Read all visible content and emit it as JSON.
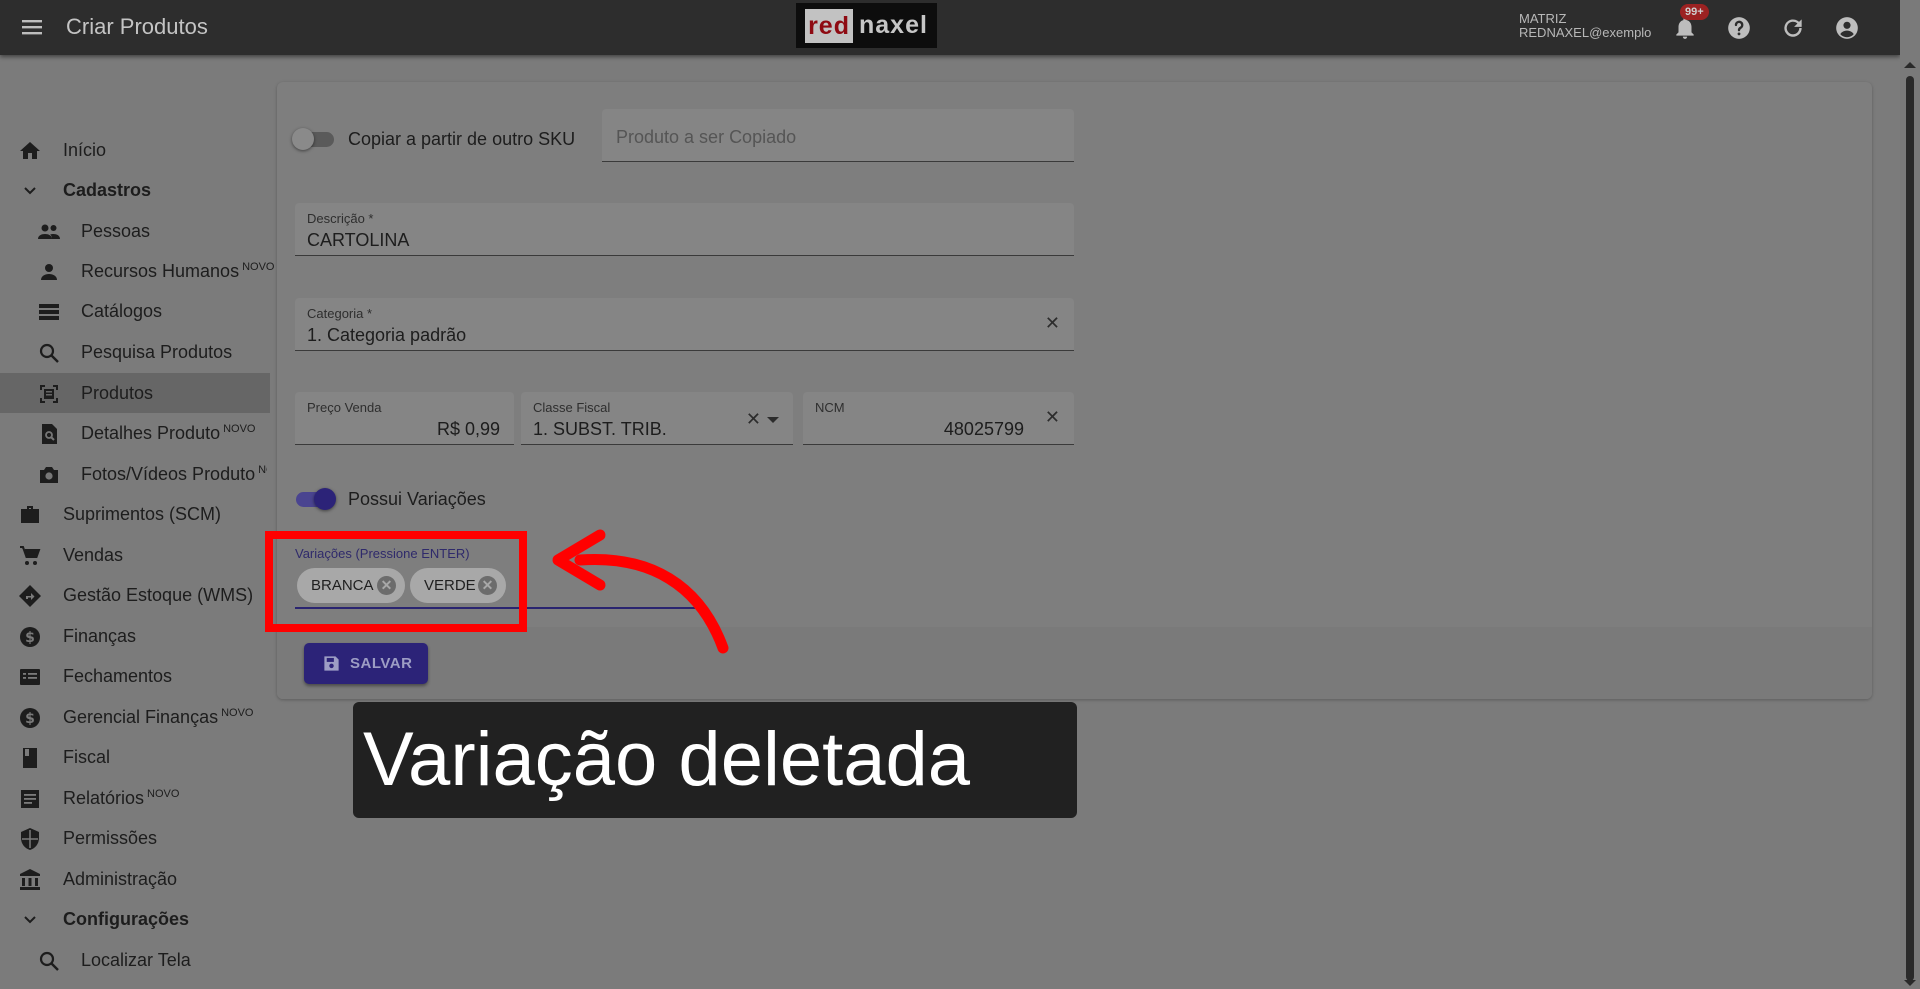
{
  "header": {
    "title": "Criar Produtos",
    "logo_red": "red",
    "logo_white": "naxel",
    "user_line1": "MATRIZ",
    "user_line2": "REDNAXEL@exemplo",
    "notification_count": "99+"
  },
  "sidebar": {
    "items": [
      {
        "label": "Início",
        "icon": "home-icon"
      },
      {
        "label": "Cadastros",
        "icon": "chevron-down-icon"
      },
      {
        "label": "Pessoas",
        "icon": "people-icon"
      },
      {
        "label": "Recursos Humanos",
        "badge": "NOVO",
        "icon": "person-icon"
      },
      {
        "label": "Catálogos",
        "icon": "list-icon"
      },
      {
        "label": "Pesquisa Produtos",
        "icon": "search-icon"
      },
      {
        "label": "Produtos",
        "icon": "product-icon"
      },
      {
        "label": "Detalhes Produto",
        "badge": "NOVO",
        "icon": "detail-search-icon"
      },
      {
        "label": "Fotos/Vídeos Produto",
        "badge": "NOVO",
        "icon": "camera-icon"
      },
      {
        "label": "Suprimentos (SCM)",
        "icon": "briefcase-icon"
      },
      {
        "label": "Vendas",
        "icon": "cart-icon"
      },
      {
        "label": "Gestão Estoque (WMS)",
        "icon": "directions-icon"
      },
      {
        "label": "Finanças",
        "icon": "dollar-icon"
      },
      {
        "label": "Fechamentos",
        "icon": "receipt-icon"
      },
      {
        "label": "Gerencial Finanças",
        "badge": "NOVO",
        "icon": "dollar-icon"
      },
      {
        "label": "Fiscal",
        "icon": "book-icon"
      },
      {
        "label": "Relatórios",
        "badge": "NOVO",
        "icon": "report-icon"
      },
      {
        "label": "Permissões",
        "icon": "shield-icon"
      },
      {
        "label": "Administração",
        "icon": "bank-icon"
      },
      {
        "label": "Configurações",
        "icon": "chevron-down-icon"
      },
      {
        "label": "Localizar Tela",
        "icon": "search-icon"
      }
    ]
  },
  "form": {
    "copy_label": "Copiar a partir de outro SKU",
    "copy_placeholder": "Produto a ser Copiado",
    "descricao_label": "Descrição *",
    "descricao_value": "CARTOLINA",
    "categoria_label": "Categoria *",
    "categoria_value": "1. Categoria padrão",
    "preco_label": "Preço Venda",
    "preco_value": "R$ 0,99",
    "classe_label": "Classe Fiscal",
    "classe_value": "1. SUBST. TRIB.",
    "ncm_label": "NCM",
    "ncm_value": "48025799",
    "variacoes_toggle_label": "Possui Variações",
    "variacoes_label": "Variações (Pressione ENTER)",
    "chips": [
      "BRANCA",
      "VERDE"
    ],
    "save_label": "SALVAR"
  },
  "annotation": {
    "caption": "Variação deletada",
    "highlight_color": "#ff0000"
  },
  "colors": {
    "accent": "#2c2378",
    "topbar": "#2d2d2d"
  }
}
